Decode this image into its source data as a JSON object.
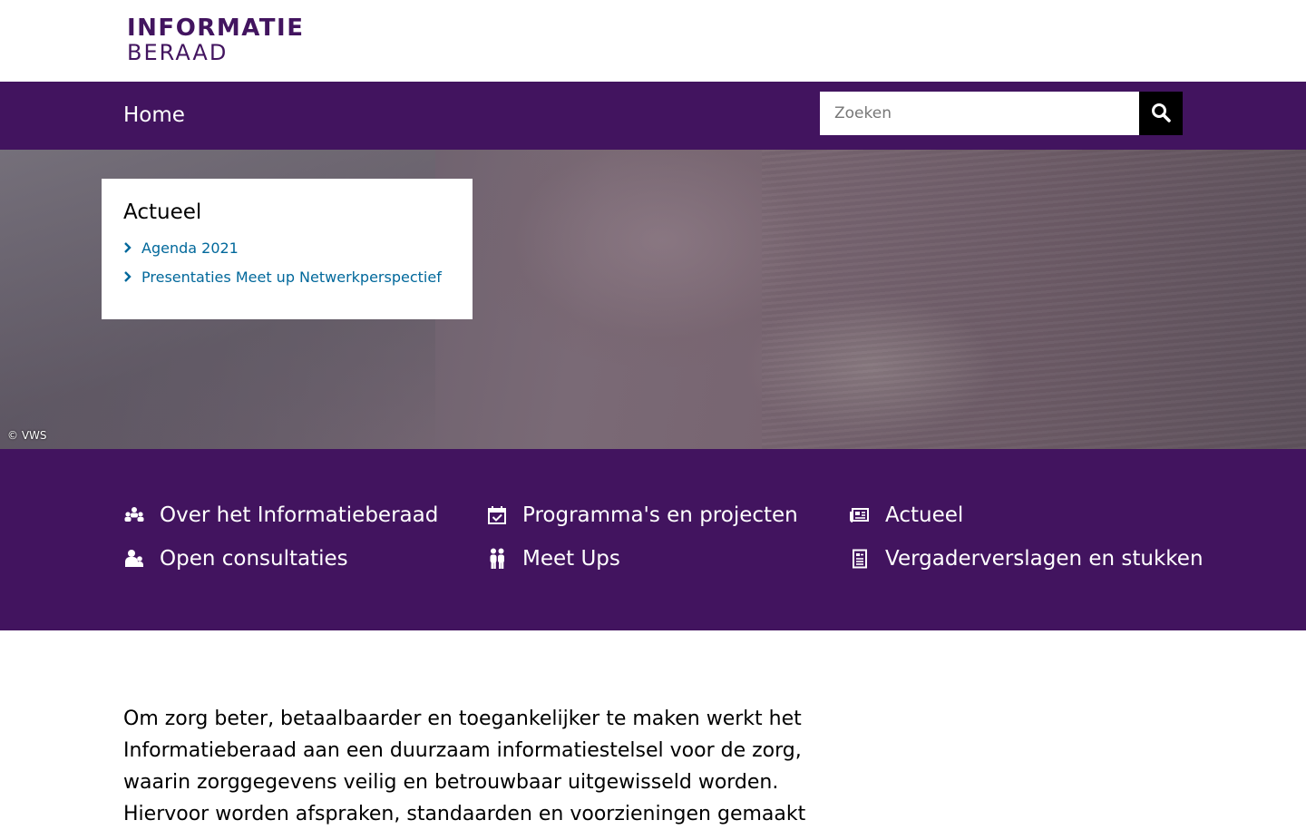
{
  "brand": {
    "logo_line1": "INFORMATIE",
    "logo_line2": "BERAAD",
    "color_purple": "#42145f",
    "color_link": "#01689b"
  },
  "nav": {
    "home_label": "Home",
    "search_placeholder": "Zoeken",
    "search_icon": "magnifier-icon"
  },
  "hero": {
    "card_title": "Actueel",
    "links": [
      "Agenda 2021",
      "Presentaties Meet up Netwerkperspectief"
    ],
    "credit": "© VWS"
  },
  "quick_links": [
    {
      "label": "Over het Informatieberaad",
      "icon": "group-icon"
    },
    {
      "label": "Programma's en projecten",
      "icon": "calendar-check-icon"
    },
    {
      "label": "Actueel",
      "icon": "newspaper-icon"
    },
    {
      "label": "Open consultaties",
      "icon": "people-consult-icon"
    },
    {
      "label": "Meet Ups",
      "icon": "two-people-icon"
    },
    {
      "label": "Vergaderverslagen en stukken",
      "icon": "document-icon"
    }
  ],
  "intro_text": "Om zorg beter, betaalbaarder en toegankelijker te maken werkt het Informatieberaad aan een duurzaam informatiestelsel voor de zorg, waarin  zorggegevens veilig en betrouwbaar uitgewisseld worden. Hiervoor worden afspraken, standaarden en voorzieningen gemaakt"
}
